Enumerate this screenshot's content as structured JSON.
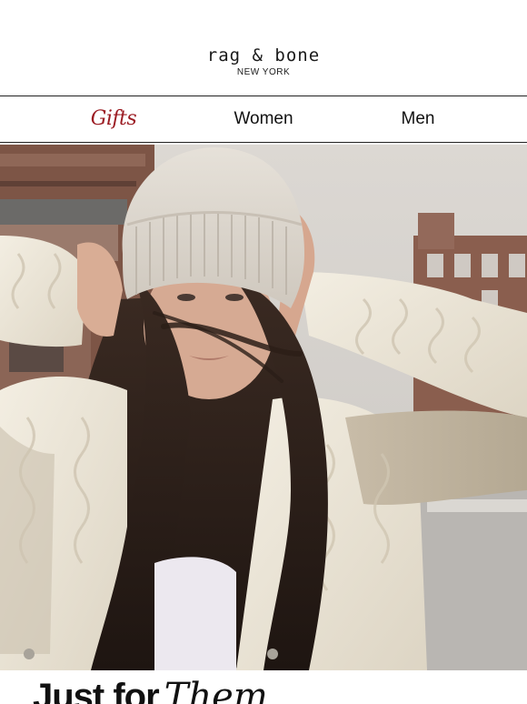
{
  "brand": {
    "name": "rag & bone",
    "location": "NEW YORK"
  },
  "nav": {
    "items": [
      {
        "label": "Gifts",
        "color": "#9b1b22"
      },
      {
        "label": "Women"
      },
      {
        "label": "Men"
      }
    ]
  },
  "hero": {
    "subject": "woman in knit beanie and cream cable-knit sweater on city street"
  },
  "headline": {
    "plain": "Just for",
    "script": "Them"
  },
  "colors": {
    "accent": "#9b1b22",
    "text": "#111111",
    "divider": "#222222"
  }
}
